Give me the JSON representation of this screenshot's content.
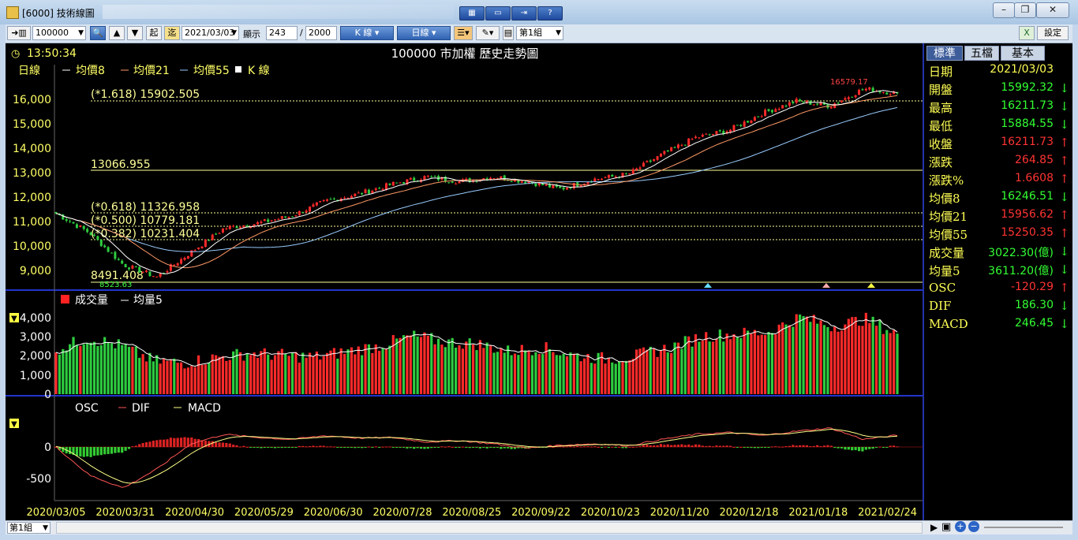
{
  "window": {
    "title": "[6000] 技術線圖",
    "buttons": [
      "minimize",
      "restore",
      "close"
    ]
  },
  "toolbar": {
    "symbol": "100000",
    "start_label": "起",
    "end_label": "迄",
    "date": "2021/03/03",
    "display_label": "顯示",
    "display_count": "243",
    "separator": "/",
    "display_total": "2000",
    "k_line_btn": "K 線",
    "period_btn": "日線",
    "group_select": "第1組",
    "settings": "設定"
  },
  "chart": {
    "time": "13:50:34",
    "title": "100000 市加權  歷史走勢圖",
    "legend": {
      "period": "日線",
      "ma8": "均價8",
      "ma21": "均價21",
      "ma55": "均價55",
      "kline": "K 線"
    },
    "fib_labels": [
      "(*1.618) 15902.505",
      "13066.955",
      "(*0.618) 11326.958",
      "(*0.500) 10779.181",
      "(*0.382) 10231.404",
      "8491.408"
    ],
    "high_marker": "16579.17",
    "low_marker": "8523.63",
    "volume_legend": {
      "volume": "成交量",
      "ma5": "均量5"
    },
    "macd_legend": {
      "osc": "OSC",
      "dif": "DIF",
      "macd": "MACD"
    },
    "colors": {
      "up": "#ff2a2a",
      "down": "#2ecc40",
      "ma8": "#ffffff",
      "ma21": "#ff9966",
      "ma55": "#99ccff",
      "fib": "#ffff99"
    }
  },
  "chart_data": [
    {
      "type": "candlestick",
      "title": "100000 市加權  歷史走勢圖",
      "y_ticks": [
        "16,000",
        "15,000",
        "14,000",
        "13,000",
        "12,000",
        "11,000",
        "10,000",
        "9,000"
      ],
      "ylim": [
        8500,
        16600
      ],
      "x_labels": [
        "2020/03/05",
        "2020/03/31",
        "2020/04/30",
        "2020/05/29",
        "2020/06/30",
        "2020/07/28",
        "2020/08/25",
        "2020/09/22",
        "2020/10/23",
        "2020/11/20",
        "2020/12/18",
        "2021/01/18",
        "2021/02/24"
      ],
      "close_anchors": [
        11300,
        10500,
        9200,
        8700,
        9700,
        10700,
        10900,
        11200,
        11800,
        12100,
        12500,
        12800,
        12600,
        12800,
        12600,
        12300,
        12700,
        12900,
        13700,
        14400,
        14700,
        15400,
        15900,
        15700,
        16400,
        16211.73
      ],
      "fib_levels": [
        15902.505,
        13066.955,
        11326.958,
        10779.181,
        10231.404,
        8491.408
      ]
    },
    {
      "type": "bar",
      "title": "成交量",
      "y_ticks": [
        "4,000",
        "3,000",
        "2,000",
        "1,000",
        "0"
      ],
      "ylim": [
        0,
        4400
      ],
      "unit": "億",
      "volume_anchors": [
        2200,
        2800,
        2400,
        1600,
        1500,
        1800,
        2000,
        1900,
        1800,
        2100,
        2400,
        2900,
        2600,
        2500,
        2100,
        2300,
        1900,
        1700,
        1900,
        2300,
        2900,
        3000,
        3100,
        3900,
        3400,
        3800,
        3022.3
      ]
    },
    {
      "type": "line",
      "title": "MACD",
      "y_ticks": [
        "0",
        "-500"
      ],
      "ylim": [
        -700,
        300
      ],
      "series": [
        {
          "name": "OSC",
          "last": -120.29
        },
        {
          "name": "DIF",
          "last": 186.3
        },
        {
          "name": "MACD",
          "last": 246.45
        }
      ],
      "dif_anchors": [
        0,
        -450,
        -650,
        -350,
        50,
        200,
        150,
        120,
        180,
        140,
        150,
        80,
        100,
        50,
        -20,
        30,
        50,
        20,
        120,
        200,
        230,
        180,
        250,
        300,
        120,
        186.3
      ]
    }
  ],
  "side": {
    "tabs": [
      "標準",
      "五檔",
      "基本"
    ],
    "rows": [
      {
        "k": "日期",
        "v": "2021/03/03",
        "color": "#ffff55",
        "arrow": ""
      },
      {
        "k": "開盤",
        "v": "15992.32",
        "color": "#33ff33",
        "arrow": "↓"
      },
      {
        "k": "最高",
        "v": "16211.73",
        "color": "#33ff33",
        "arrow": "↓"
      },
      {
        "k": "最低",
        "v": "15884.55",
        "color": "#33ff33",
        "arrow": "↓"
      },
      {
        "k": "收盤",
        "v": "16211.73",
        "color": "#ff3333",
        "arrow": "↑"
      },
      {
        "k": "漲跌",
        "v": "264.85",
        "color": "#ff3333",
        "arrow": "↑"
      },
      {
        "k": "漲跌%",
        "v": "1.6608",
        "color": "#ff3333",
        "arrow": "↑"
      },
      {
        "k": "均價8",
        "v": "16246.51",
        "color": "#33ff33",
        "arrow": "↓"
      },
      {
        "k": "均價21",
        "v": "15956.62",
        "color": "#ff3333",
        "arrow": "↑"
      },
      {
        "k": "均價55",
        "v": "15250.35",
        "color": "#ff3333",
        "arrow": "↑"
      },
      {
        "k": "成交量",
        "v": "3022.30(億)",
        "color": "#33ff33",
        "arrow": "↓"
      },
      {
        "k": "均量5",
        "v": "3611.20(億)",
        "color": "#33ff33",
        "arrow": "↓"
      },
      {
        "k": "OSC",
        "v": "-120.29",
        "color": "#ff3333",
        "arrow": "↑"
      },
      {
        "k": "DIF",
        "v": "186.30",
        "color": "#33ff33",
        "arrow": "↓"
      },
      {
        "k": "MACD",
        "v": "246.45",
        "color": "#33ff33",
        "arrow": "↓"
      }
    ]
  },
  "status": {
    "group": "第1組"
  }
}
